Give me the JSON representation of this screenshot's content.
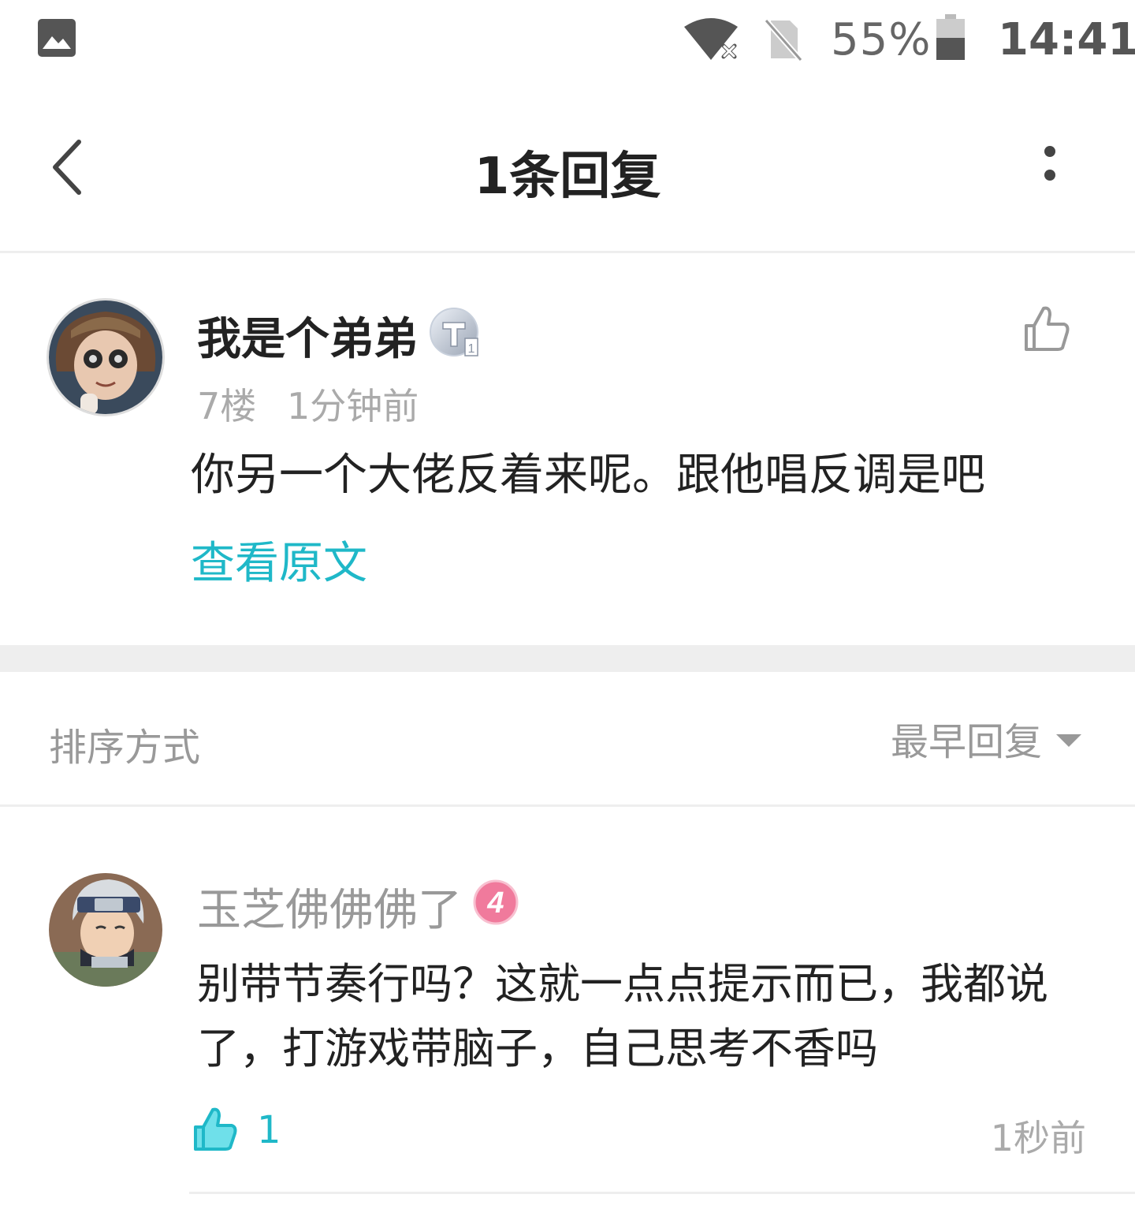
{
  "status_bar": {
    "battery_text": "55%",
    "time": "14:41",
    "icons": [
      "gallery-icon",
      "wifi-icon",
      "no-sim-icon",
      "battery-icon"
    ]
  },
  "header": {
    "title": "1条回复",
    "back_icon": "chevron-left-icon",
    "more_icon": "more-vertical-icon"
  },
  "post": {
    "author": "我是个弟弟",
    "badge_icon": "level-t-badge-icon",
    "floor": "7楼",
    "time": "1分钟前",
    "content": "你另一个大佬反着来呢。跟他唱反调是吧",
    "view_original": "查看原文"
  },
  "sort": {
    "label": "排序方式",
    "value": "最早回复"
  },
  "reply": {
    "author": "玉芝佛佛佛了",
    "level": "4",
    "content": "别带节奏行吗？这就一点点提示而已，我都说了，打游戏带脑子，自己思考不香吗",
    "like_count": "1",
    "time": "1秒前"
  },
  "colors": {
    "accent": "#1fb8c8",
    "muted_text": "#999999",
    "divider": "#eeeeee",
    "level_badge_pink": "#f07a9c"
  }
}
